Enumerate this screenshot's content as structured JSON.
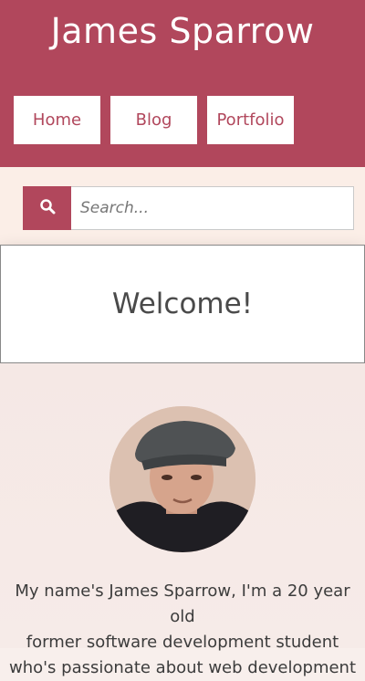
{
  "site": {
    "title": "James Sparrow"
  },
  "nav": {
    "items": [
      {
        "label": "Home"
      },
      {
        "label": "Blog"
      },
      {
        "label": "Portfolio"
      }
    ]
  },
  "search": {
    "placeholder": "Search...",
    "icon": "search-icon"
  },
  "welcome": {
    "title": "Welcome!"
  },
  "profile": {
    "avatar_icon": "profile-photo",
    "bio_lines": [
      "My name's James Sparrow, I'm a 20 year old",
      "former software development student",
      "who's passionate about web development"
    ]
  },
  "colors": {
    "brand": "#b1475c",
    "band": "#fbeee7"
  }
}
